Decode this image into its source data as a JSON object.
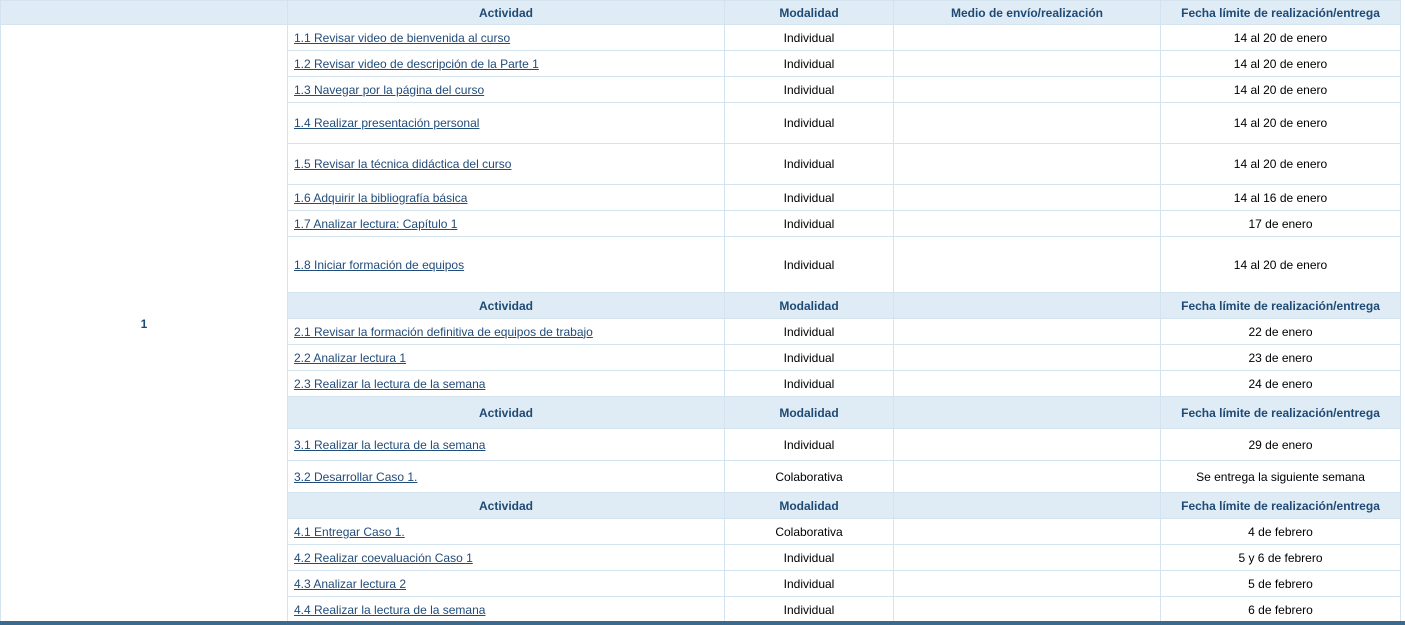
{
  "week_label": "1",
  "headers": {
    "actividad": "Actividad",
    "modalidad": "Modalidad",
    "medio": "Medio de envío/realización",
    "fecha": "Fecha límite de realización/entrega"
  },
  "sections": [
    {
      "rows": [
        {
          "actividad": "1.1 Revisar video de bienvenida al curso",
          "modalidad": "Individual",
          "fecha": "14 al 20 de enero"
        },
        {
          "actividad": "1.2 Revisar video de descripción de la Parte 1",
          "modalidad": "Individual",
          "fecha": "14 al 20 de enero"
        },
        {
          "actividad": "1.3 Navegar por la página del curso",
          "modalidad": "Individual",
          "fecha": "14 al 20 de enero"
        },
        {
          "actividad": "1.4 Realizar presentación  personal",
          "modalidad": "Individual",
          "fecha": "14 al 20 de enero"
        },
        {
          "actividad": "1.5 Revisar la técnica didáctica del curso",
          "modalidad": "Individual",
          "fecha": "14 al 20 de enero"
        },
        {
          "actividad": "1.6 Adquirir la bibliografía básica",
          "modalidad": "Individual",
          "fecha": "14 al 16 de enero"
        },
        {
          "actividad": "1.7 Analizar lectura: Capítulo 1",
          "modalidad": "Individual",
          "fecha": "17 de enero"
        },
        {
          "actividad": "1.8 Iniciar formación de equipos",
          "modalidad": "Individual",
          "fecha": "14 al 20 de enero"
        }
      ]
    },
    {
      "rows": [
        {
          "actividad": "2.1 Revisar la formación definitiva de equipos de trabajo",
          "modalidad": "Individual",
          "fecha": "22 de enero"
        },
        {
          "actividad": "2.2 Analizar lectura 1",
          "modalidad": "Individual",
          "fecha": "23 de enero"
        },
        {
          "actividad": "2.3 Realizar la lectura de la semana",
          "modalidad": "Individual",
          "fecha": "24 de enero"
        }
      ]
    },
    {
      "rows": [
        {
          "actividad": "3.1 Realizar la lectura de la semana",
          "modalidad": "Individual",
          "fecha": "29 de enero"
        },
        {
          "actividad": "3.2 Desarrollar Caso 1.",
          "modalidad": "Colaborativa",
          "fecha": "Se entrega la siguiente semana"
        }
      ]
    },
    {
      "rows": [
        {
          "actividad": "4.1 Entregar Caso 1.",
          "modalidad": "Colaborativa",
          "fecha": "4 de febrero"
        },
        {
          "actividad": "4.2 Realizar coevaluación Caso 1",
          "modalidad": "Individual",
          "fecha": "5 y 6 de febrero"
        },
        {
          "actividad": "4.3 Analizar lectura 2",
          "modalidad": "Individual",
          "fecha": "5 de febrero"
        },
        {
          "actividad": "4.4 Realizar la lectura de la semana",
          "modalidad": "Individual",
          "fecha": "6 de febrero"
        }
      ]
    }
  ]
}
